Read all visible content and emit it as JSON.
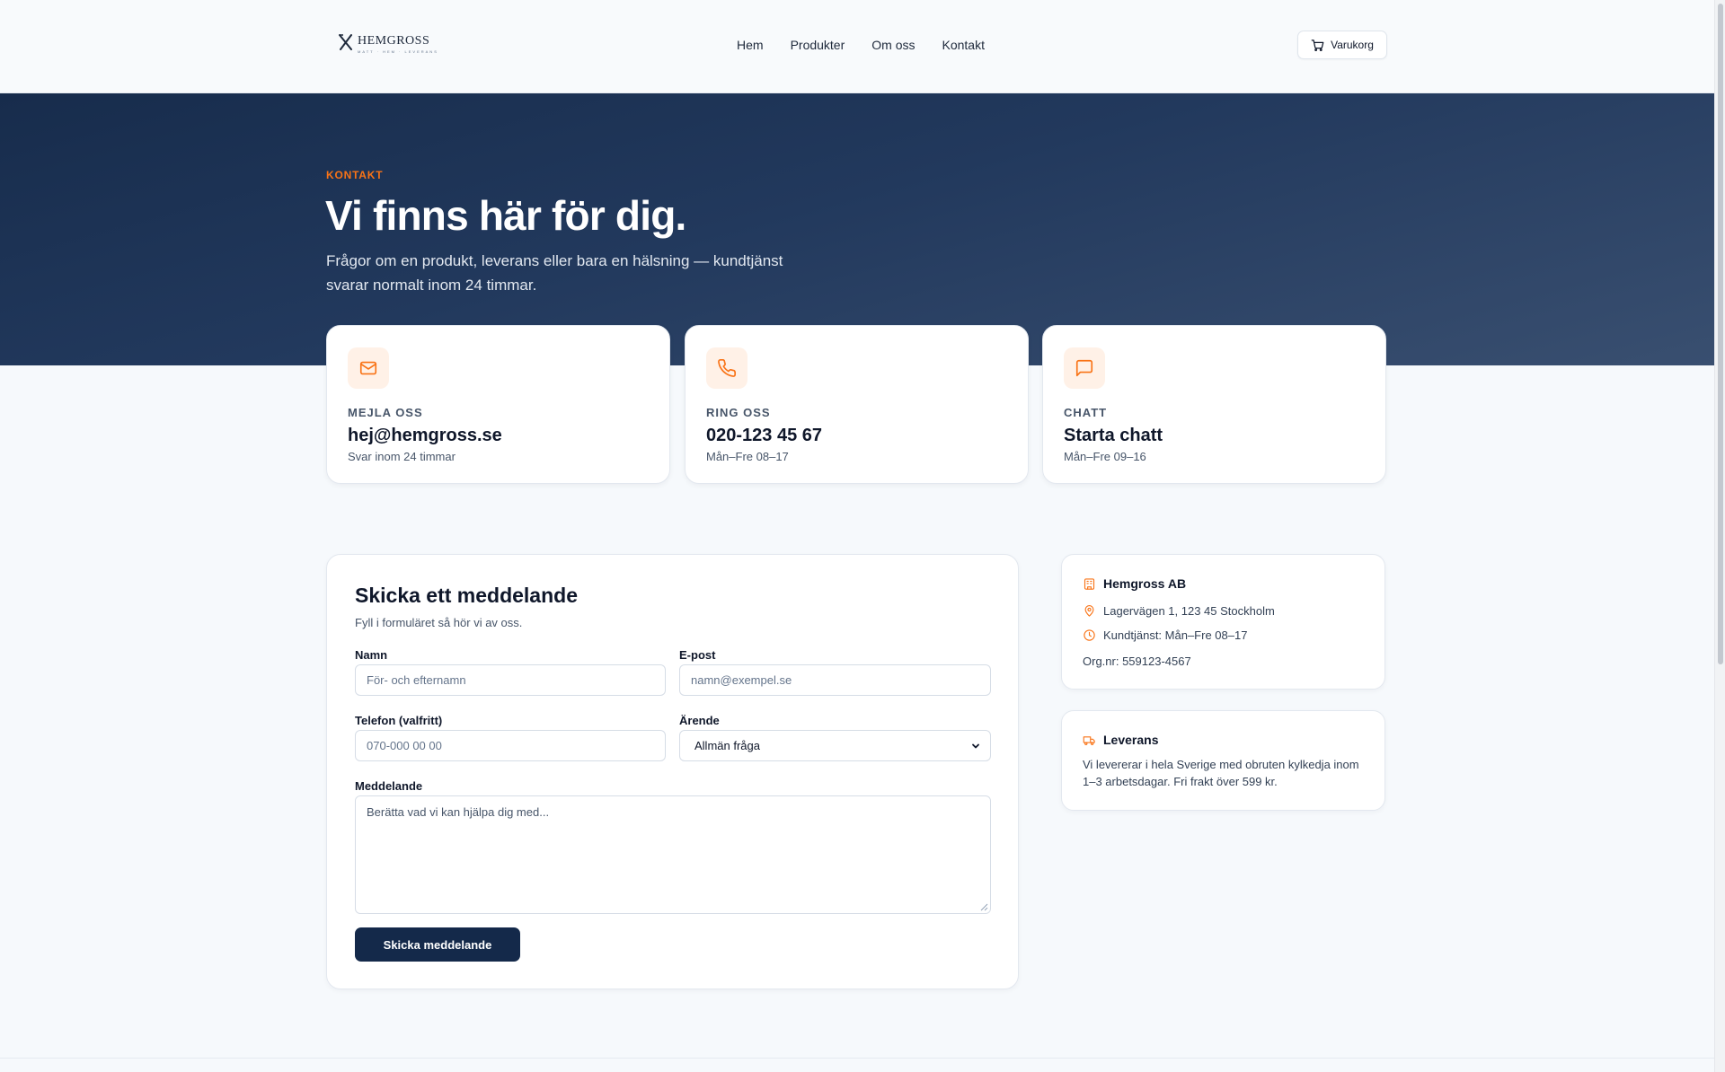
{
  "header": {
    "logo_name": "HEMGROSS",
    "logo_tagline": "MATT · HEM · LEVERANS",
    "nav": [
      "Hem",
      "Produkter",
      "Om oss",
      "Kontakt"
    ],
    "cart_label": "Varukorg"
  },
  "hero": {
    "eyebrow": "KONTAKT",
    "title": "Vi finns här för dig.",
    "subtitle": "Frågor om en produkt, leverans eller bara en hälsning — kundtjänst svarar normalt inom 24 timmar."
  },
  "contact_cards": [
    {
      "icon": "mail-icon",
      "label": "MEJLA OSS",
      "value": "hej@hemgross.se",
      "note": "Svar inom 24 timmar"
    },
    {
      "icon": "phone-icon",
      "label": "RING OSS",
      "value": "020-123 45 67",
      "note": "Mån–Fre 08–17"
    },
    {
      "icon": "chat-icon",
      "label": "CHATT",
      "value": "Starta chatt",
      "note": "Mån–Fre 09–16"
    }
  ],
  "form": {
    "title": "Skicka ett meddelande",
    "subtitle": "Fyll i formuläret så hör vi av oss.",
    "name_label": "Namn",
    "name_placeholder": "För- och efternamn",
    "email_label": "E-post",
    "email_placeholder": "namn@exempel.se",
    "phone_label": "Telefon (valfritt)",
    "phone_placeholder": "070-000 00 00",
    "subject_label": "Ärende",
    "subject_value": "Allmän fråga",
    "message_label": "Meddelande",
    "message_placeholder": "Berätta vad vi kan hjälpa dig med...",
    "submit_label": "Skicka meddelande"
  },
  "company": {
    "name": "Hemgross AB",
    "address": "Lagervägen 1, 123 45 Stockholm",
    "hours": "Kundtjänst: Mån–Fre 08–17",
    "org_nr": "Org.nr: 559123-4567"
  },
  "delivery": {
    "title": "Leverans",
    "text": "Vi levererar i hela Sverige med obruten kylkedja inom 1–3 arbetsdagar. Fri frakt över 599 kr."
  },
  "colors": {
    "accent": "#f97316",
    "navy": "#14294a",
    "hero_start": "#172c4c",
    "hero_end": "#394f70"
  }
}
